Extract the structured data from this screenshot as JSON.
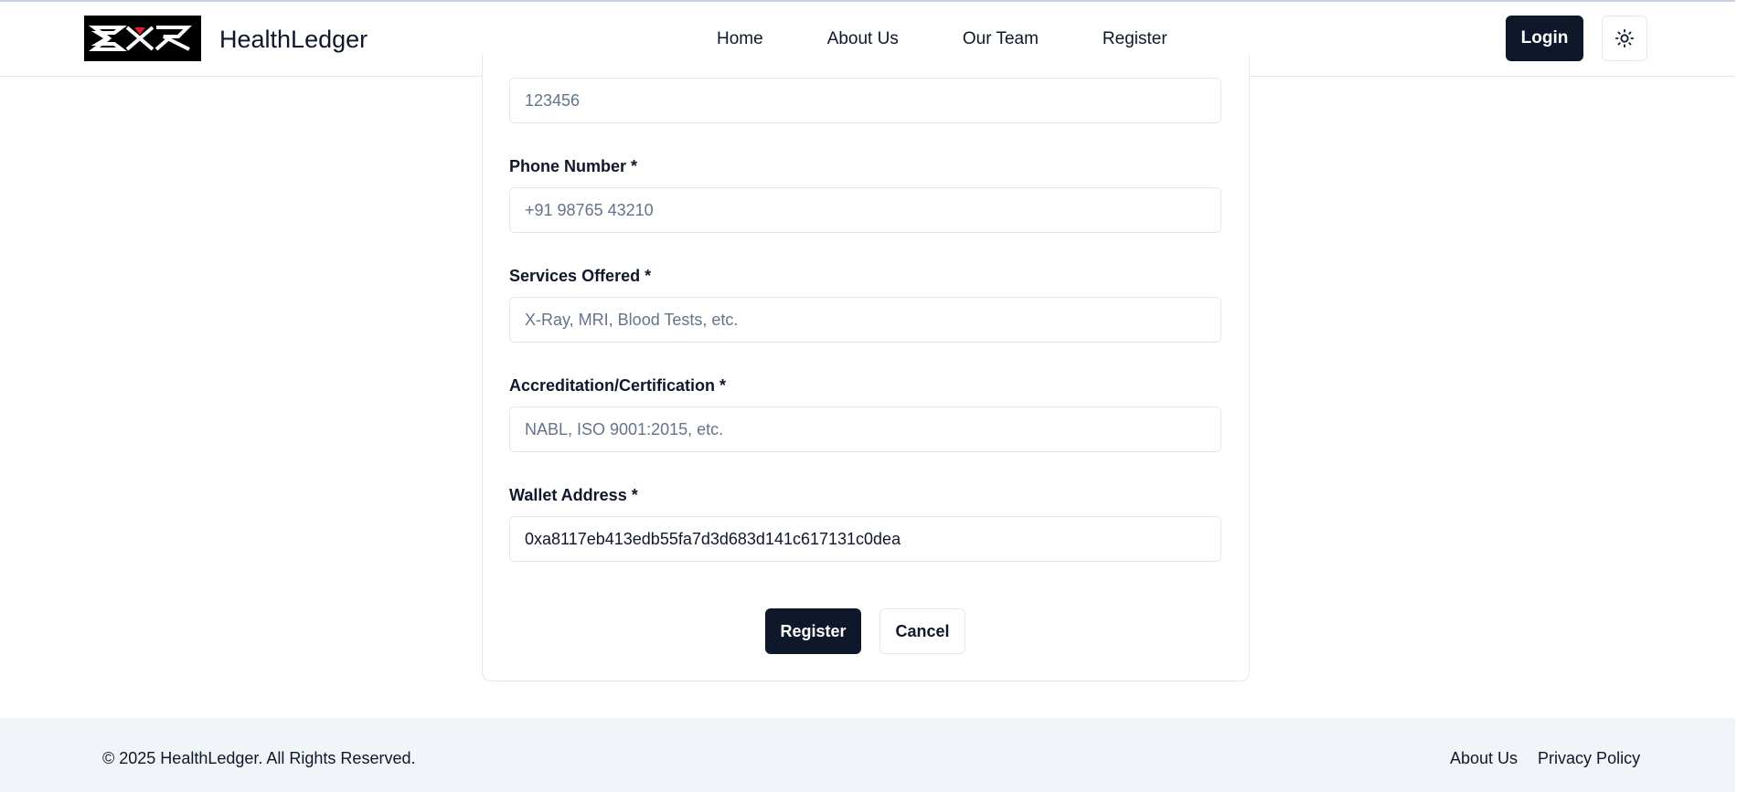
{
  "header": {
    "brand": "HealthLedger",
    "logo_text": "EXR",
    "nav": [
      "Home",
      "About Us",
      "Our Team",
      "Register"
    ],
    "login_label": "Login",
    "theme_icon": "sun-icon"
  },
  "form": {
    "top_field": {
      "placeholder": "123456",
      "value": ""
    },
    "fields": [
      {
        "label": "Phone Number *",
        "placeholder": "+91 98765 43210",
        "value": ""
      },
      {
        "label": "Services Offered *",
        "placeholder": "X-Ray, MRI, Blood Tests, etc.",
        "value": ""
      },
      {
        "label": "Accreditation/Certification *",
        "placeholder": "NABL, ISO 9001:2015, etc.",
        "value": ""
      },
      {
        "label": "Wallet Address *",
        "placeholder": "",
        "value": "0xa8117eb413edb55fa7d3d683d141c617131c0dea"
      }
    ],
    "register_label": "Register",
    "cancel_label": "Cancel"
  },
  "footer": {
    "copyright": "© 2025 HealthLedger. All Rights Reserved.",
    "links": [
      "About Us",
      "Privacy Policy"
    ]
  },
  "colors": {
    "primary": "#0f172a",
    "footer_bg": "#f1f5f9",
    "border": "#e5e7eb",
    "placeholder": "#64748b"
  }
}
